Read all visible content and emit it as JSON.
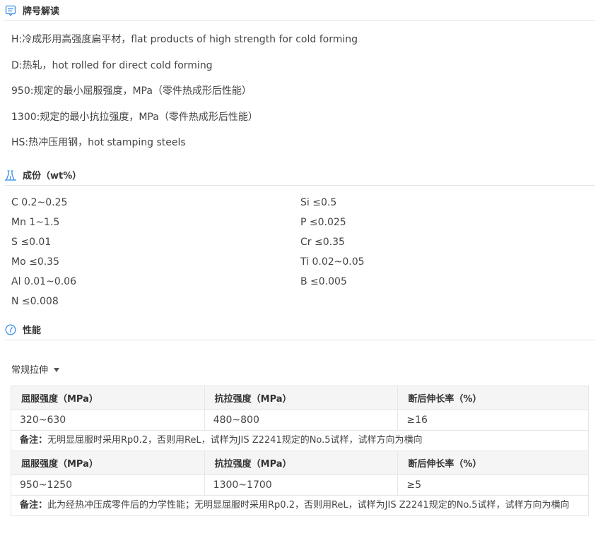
{
  "sections": {
    "designation": {
      "title": "牌号解读"
    },
    "composition": {
      "title": "成份（wt%）"
    },
    "properties": {
      "title": "性能"
    }
  },
  "designation_lines": [
    "H:冷成形用高强度扁平材，flat products of high strength for cold forming",
    "D:热轧，hot rolled for direct cold forming",
    "950:规定的最小屈服强度，MPa（零件热成形后性能）",
    "1300:规定的最小抗拉强度，MPa（零件热成形后性能）",
    "HS:热冲压用钢，hot stamping steels"
  ],
  "composition": [
    [
      "C 0.2~0.25",
      "Si ≤0.5"
    ],
    [
      "Mn 1~1.5",
      "P ≤0.025"
    ],
    [
      "S ≤0.01",
      "Cr ≤0.35"
    ],
    [
      "Mo ≤0.35",
      "Ti 0.02~0.05"
    ],
    [
      "Al 0.01~0.06",
      "B ≤0.005"
    ],
    [
      "N ≤0.008",
      ""
    ]
  ],
  "tab": {
    "label": "常规拉伸"
  },
  "table": {
    "headers": [
      "屈服强度（MPa）",
      "抗拉强度（MPa）",
      "断后伸长率（%）"
    ],
    "blocks": [
      {
        "values": [
          "320~630",
          "480~800",
          "≥16"
        ],
        "note_label": "备注：",
        "note_text": "无明显屈服时采用Rp0.2，否则用ReL，试样为JIS Z2241规定的No.5试样，试样方向为横向"
      },
      {
        "values": [
          "950~1250",
          "1300~1700",
          "≥5"
        ],
        "note_label": "备注：",
        "note_text": "此为经热冲压成零件后的力学性能；无明显屈服时采用Rp0.2，否则用ReL，试样为JIS Z2241规定的No.5试样，试样方向为横向"
      }
    ]
  },
  "colors": {
    "accent": "#3a8ee6"
  }
}
